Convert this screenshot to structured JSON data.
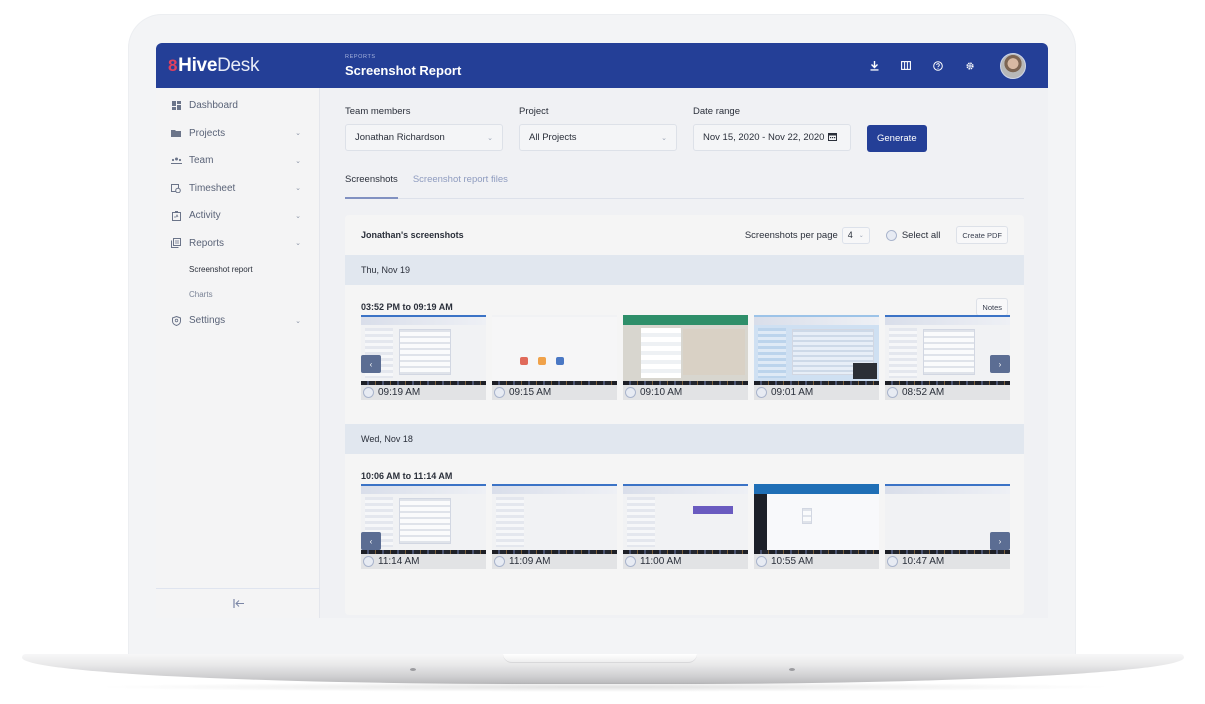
{
  "app": {
    "brand_mark": "8",
    "brand_bold": "Hive",
    "brand_light": "Desk",
    "eyebrow": "REPORTS",
    "page_title": "Screenshot Report",
    "colors": {
      "primary": "#243f97",
      "brand_accent": "#e0415f",
      "day_bar": "#e1e7ef"
    }
  },
  "topbar": {
    "icons": [
      "download-icon",
      "columns-icon",
      "help-icon",
      "settings-icon"
    ],
    "avatar_alt": "User avatar"
  },
  "sidebar": {
    "items": [
      {
        "label": "Dashboard",
        "icon": "dashboard-icon",
        "chevron": false
      },
      {
        "label": "Projects",
        "icon": "folder-icon",
        "chevron": true
      },
      {
        "label": "Team",
        "icon": "team-icon",
        "chevron": true
      },
      {
        "label": "Timesheet",
        "icon": "timesheet-icon",
        "chevron": true
      },
      {
        "label": "Activity",
        "icon": "activity-icon",
        "chevron": true
      },
      {
        "label": "Reports",
        "icon": "reports-icon",
        "chevron": true
      }
    ],
    "sub_items": [
      {
        "label": "Screenshot report",
        "active": true
      },
      {
        "label": "Charts",
        "active": false
      }
    ],
    "settings": {
      "label": "Settings",
      "icon": "settings-shield-icon"
    },
    "collapse_icon": "collapse-left-icon"
  },
  "filters": {
    "team_members": {
      "label": "Team members",
      "value": "Jonathan Richardson"
    },
    "project": {
      "label": "Project",
      "value": "All Projects"
    },
    "date_range": {
      "label": "Date range",
      "value": "Nov 15, 2020 - Nov 22, 2020"
    },
    "generate_label": "Generate"
  },
  "tabs": [
    {
      "label": "Screenshots",
      "active": true
    },
    {
      "label": "Screenshot report files",
      "active": false
    }
  ],
  "report": {
    "title": "Jonathan's screenshots",
    "per_page_label": "Screenshots per page",
    "per_page_value": "4",
    "select_all_label": "Select all",
    "create_pdf_label": "Create PDF",
    "notes_label": "Notes",
    "days": [
      {
        "date": "Thu, Nov 19",
        "session": "03:52 PM to 09:19 AM",
        "shots": [
          "09:19 AM",
          "09:15 AM",
          "09:10 AM",
          "09:01 AM",
          "08:52 AM"
        ]
      },
      {
        "date": "Wed, Nov 18",
        "session": "10:06 AM to 11:14 AM",
        "shots": [
          "11:14 AM",
          "11:09 AM",
          "11:00 AM",
          "10:55 AM",
          "10:47 AM"
        ]
      }
    ]
  }
}
